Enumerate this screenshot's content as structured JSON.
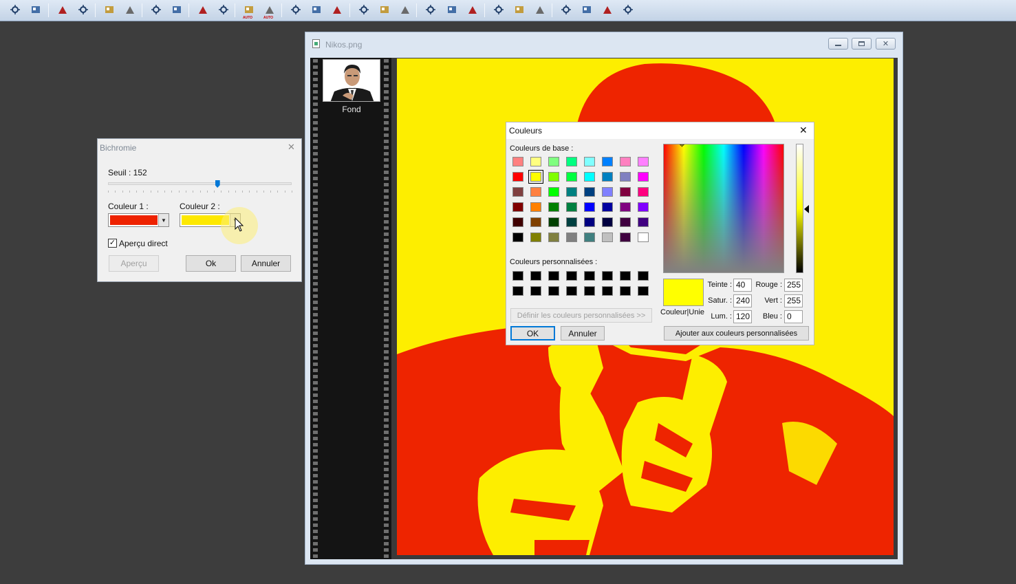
{
  "toolbar": {
    "buttons": [
      {
        "icon": "brightness-plus-icon"
      },
      {
        "icon": "brightness-more-icon"
      },
      {
        "icon": "contrast-minus-icon"
      },
      {
        "icon": "contrast-plus-icon"
      },
      {
        "icon": "gamma-minus-icon"
      },
      {
        "icon": "gamma-plus-icon"
      },
      {
        "icon": "color-balance-icon"
      },
      {
        "icon": "color-balance-plus-icon"
      },
      {
        "icon": "levels-icon"
      },
      {
        "icon": "curves-icon"
      },
      {
        "icon": "auto-gamma-icon"
      },
      {
        "icon": "auto-contrast-icon"
      },
      {
        "icon": "grid-filter-icon"
      },
      {
        "icon": "grid-filter-2-icon"
      },
      {
        "icon": "grid-filter-3-icon"
      },
      {
        "icon": "channel-icon"
      },
      {
        "icon": "drop-icon"
      },
      {
        "icon": "drop-outline-icon"
      },
      {
        "icon": "mountain-icon"
      },
      {
        "icon": "cone-icon"
      },
      {
        "icon": "cone-outline-icon"
      },
      {
        "icon": "rgb-palette-icon"
      },
      {
        "icon": "screen-palette-icon"
      },
      {
        "icon": "mask-icon"
      },
      {
        "icon": "page-icon"
      },
      {
        "icon": "film-icon"
      },
      {
        "icon": "export-icon"
      },
      {
        "icon": "import-icon"
      }
    ],
    "auto_label": "AUTO"
  },
  "image_window": {
    "title": "Nikos.png",
    "layer_label": "Fond"
  },
  "bichromie": {
    "title": "Bichromie",
    "threshold_label": "Seuil : 152",
    "threshold_value": 152,
    "threshold_max": 255,
    "color1_label": "Couleur 1 :",
    "color1": "#ee2200",
    "color2_label": "Couleur 2 :",
    "color2": "#fde800",
    "preview_live_label": "Aperçu direct",
    "preview_live_checked": true,
    "preview_button": "Aperçu",
    "ok_button": "Ok",
    "cancel_button": "Annuler"
  },
  "couleurs": {
    "title": "Couleurs",
    "basic_label": "Couleurs de base :",
    "basic_colors": [
      [
        "#ff8080",
        "#ffff80",
        "#80ff80",
        "#00ff80",
        "#80ffff",
        "#0080ff",
        "#ff80c0",
        "#ff80ff"
      ],
      [
        "#ff0000",
        "#ffff00",
        "#80ff00",
        "#00ff40",
        "#00ffff",
        "#0080c0",
        "#8080c0",
        "#ff00ff"
      ],
      [
        "#804040",
        "#ff8040",
        "#00ff00",
        "#008080",
        "#004080",
        "#8080ff",
        "#800040",
        "#ff0080"
      ],
      [
        "#800000",
        "#ff8000",
        "#008000",
        "#008040",
        "#0000ff",
        "#0000a0",
        "#800080",
        "#8000ff"
      ],
      [
        "#400000",
        "#804000",
        "#004000",
        "#004040",
        "#000080",
        "#000040",
        "#400040",
        "#400080"
      ],
      [
        "#000000",
        "#808000",
        "#808040",
        "#808080",
        "#408080",
        "#c0c0c0",
        "#400040",
        "#ffffff"
      ]
    ],
    "selected_basic": [
      1,
      1
    ],
    "custom_label": "Couleurs personnalisées :",
    "custom_colors": [
      [
        "#000000",
        "#000000",
        "#000000",
        "#000000",
        "#000000",
        "#000000",
        "#000000",
        "#000000"
      ],
      [
        "#000000",
        "#000000",
        "#000000",
        "#000000",
        "#000000",
        "#000000",
        "#000000",
        "#000000"
      ]
    ],
    "define_custom_button": "Définir les couleurs personnalisées >>",
    "ok_button": "OK",
    "cancel_button": "Annuler",
    "solid_label": "Couleur|Unie",
    "current_color": "#ffff00",
    "hue_label": "Teinte :",
    "hue": "40",
    "sat_label": "Satur. :",
    "sat": "240",
    "lum_label": "Lum. :",
    "lum": "120",
    "red_label": "Rouge :",
    "red": "255",
    "green_label": "Vert :",
    "green": "255",
    "blue_label": "Bleu :",
    "blue": "0",
    "add_custom_button": "Ajouter aux couleurs personnalisées"
  }
}
